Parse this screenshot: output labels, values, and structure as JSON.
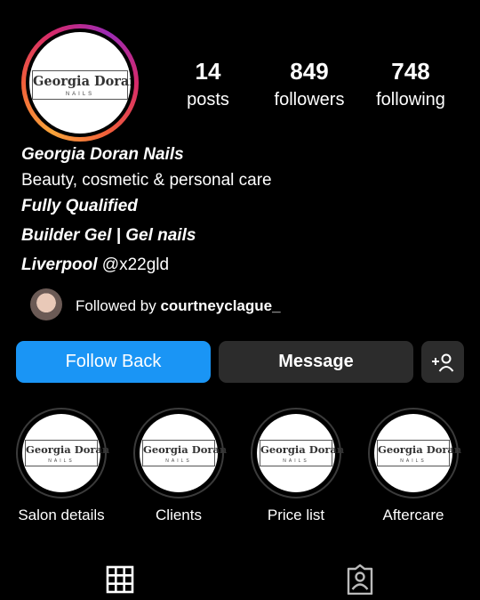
{
  "profile": {
    "logo_name": "Georgia Doran",
    "logo_sub": "NAILS",
    "name": "Georgia Doran Nails",
    "category": "Beauty, cosmetic & personal care",
    "bio_line1": "Fully Qualified",
    "bio_line2": "Builder Gel | Gel nails",
    "location": "Liverpool",
    "handle": "@x22gld"
  },
  "stats": [
    {
      "value": "14",
      "label": "posts"
    },
    {
      "value": "849",
      "label": "followers"
    },
    {
      "value": "748",
      "label": "following"
    }
  ],
  "followed_by": {
    "prefix": "Followed by",
    "user": "courtneyclague_"
  },
  "buttons": {
    "follow_back": "Follow Back",
    "message": "Message"
  },
  "highlights": [
    {
      "label": "Salon details"
    },
    {
      "label": "Clients"
    },
    {
      "label": "Price list"
    },
    {
      "label": "Aftercare"
    }
  ],
  "tabs": [
    {
      "icon": "grid-icon",
      "active": true
    },
    {
      "icon": "tagged-icon",
      "active": false
    }
  ],
  "colors": {
    "accent": "#1a95f5",
    "background": "#000000",
    "button_dark": "#2c2c2c"
  }
}
